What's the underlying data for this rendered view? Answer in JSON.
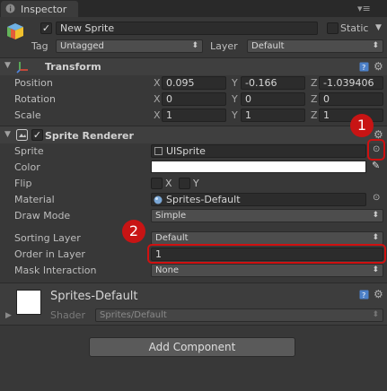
{
  "tab": {
    "title": "Inspector"
  },
  "object": {
    "name": "New Sprite",
    "static_label": "Static",
    "tag_label": "Tag",
    "tag_value": "Untagged",
    "layer_label": "Layer",
    "layer_value": "Default"
  },
  "transform": {
    "title": "Transform",
    "rows": [
      {
        "label": "Position",
        "x": "0.095",
        "y": "-0.166",
        "z": "-1.039406"
      },
      {
        "label": "Rotation",
        "x": "0",
        "y": "0",
        "z": "0"
      },
      {
        "label": "Scale",
        "x": "1",
        "y": "1",
        "z": "1"
      }
    ],
    "axes": {
      "x": "X",
      "y": "Y",
      "z": "Z"
    }
  },
  "sprite_renderer": {
    "title": "Sprite Renderer",
    "sprite_label": "Sprite",
    "sprite_value": "UISprite",
    "color_label": "Color",
    "color_value": "#ffffff",
    "flip_label": "Flip",
    "flip_x": "X",
    "flip_y": "Y",
    "material_label": "Material",
    "material_value": "Sprites-Default",
    "draw_mode_label": "Draw Mode",
    "draw_mode_value": "Simple",
    "sorting_layer_label": "Sorting Layer",
    "sorting_layer_value": "Default",
    "order_label": "Order in Layer",
    "order_value": "1",
    "mask_label": "Mask Interaction",
    "mask_value": "None"
  },
  "material_panel": {
    "name": "Sprites-Default",
    "shader_label": "Shader",
    "shader_value": "Sprites/Default"
  },
  "add_component": {
    "label": "Add Component"
  },
  "annotations": {
    "badge1": "1",
    "badge2": "2",
    "accent": "#c81414"
  }
}
